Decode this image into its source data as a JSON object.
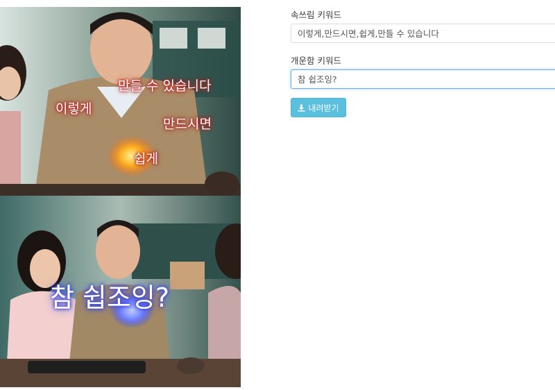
{
  "meme": {
    "top_panel_captions": [
      "만들 수 있습니다",
      "이렇게",
      "만드시면",
      "쉽게"
    ],
    "bottom_panel_caption": "참 쉽조잉?"
  },
  "form": {
    "whisper_label": "속쓰림 키워드",
    "whisper_value": "이렇게,만드시면,쉽게,만들 수 있습니다",
    "refreshing_label": "개운함 키워드",
    "refreshing_value": "참 쉽조잉?",
    "download_label": "내려받기",
    "download_icon": "download-icon"
  },
  "colors": {
    "button_bg": "#5bc0de",
    "focus_border": "#66afe9",
    "caption_glow_red": "#d22a2a",
    "caption_glow_blue": "#4d5cf0"
  }
}
